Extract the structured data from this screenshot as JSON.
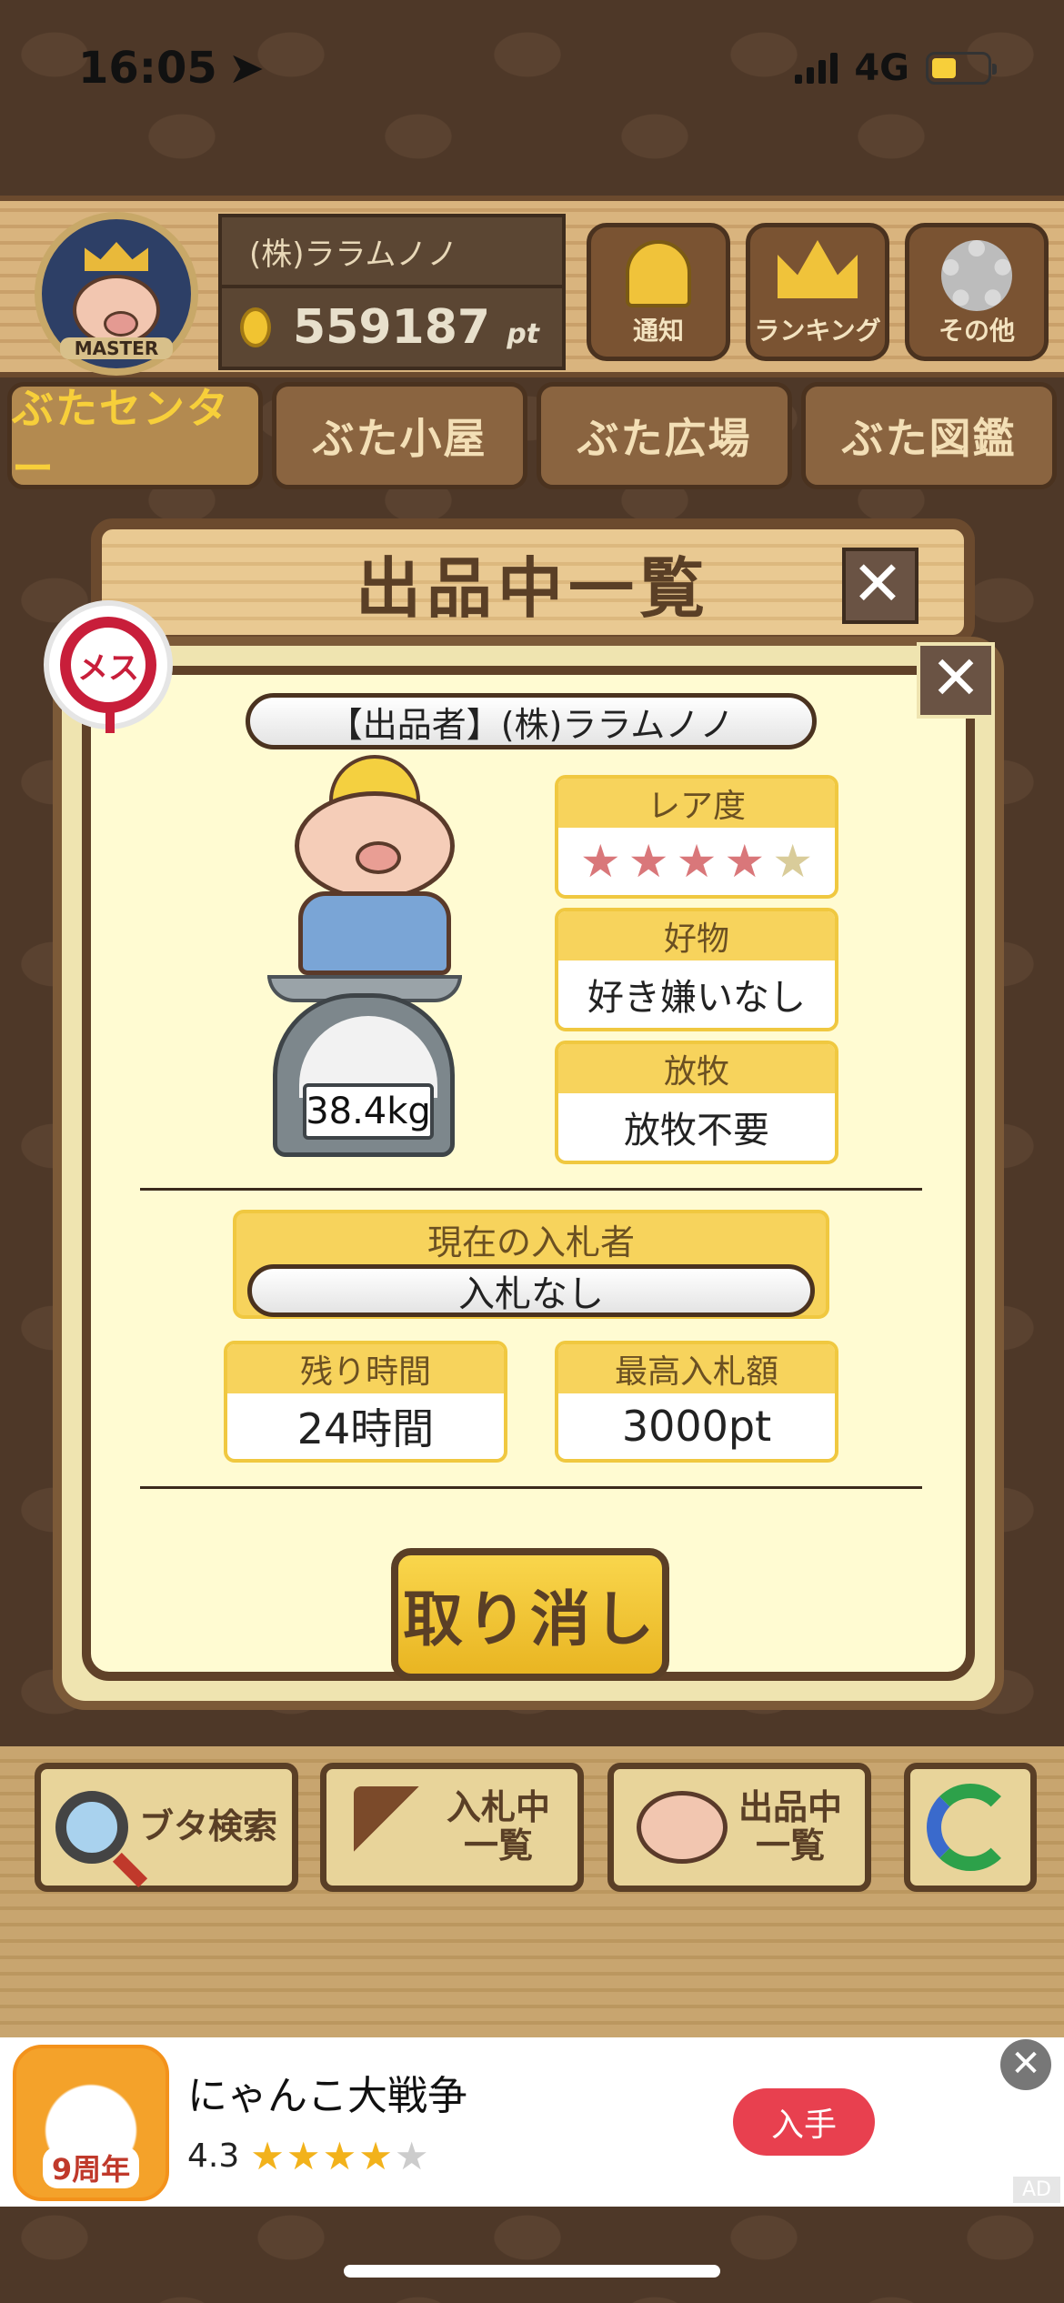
{
  "status_bar": {
    "time": "16:05",
    "network": "4G",
    "battery_level": 0.45
  },
  "header": {
    "badge_label": "MASTER",
    "user_name": "(株)ララムノノ",
    "points": "559187",
    "points_unit": "pt",
    "buttons": [
      {
        "label": "通知",
        "icon": "bell-icon"
      },
      {
        "label": "ランキング",
        "icon": "crown-icon"
      },
      {
        "label": "その他",
        "icon": "gear-icon"
      }
    ]
  },
  "tabs": [
    {
      "label": "ぶたセンター",
      "active": true
    },
    {
      "label": "ぶた小屋",
      "active": false
    },
    {
      "label": "ぶた広場",
      "active": false
    },
    {
      "label": "ぶた図鑑",
      "active": false
    }
  ],
  "modal": {
    "title": "出品中一覧",
    "close": "✕"
  },
  "listing": {
    "gender": "メス",
    "seller": "【出品者】(株)ララムノノ",
    "weight": "38.4kg",
    "rarity": {
      "label": "レア度",
      "stars": 4,
      "max_stars": 5
    },
    "favorite": {
      "label": "好物",
      "value": "好き嫌いなし"
    },
    "grazing": {
      "label": "放牧",
      "value": "放牧不要"
    },
    "current_bidder": {
      "label": "現在の入札者",
      "value": "入札なし"
    },
    "remaining_time": {
      "label": "残り時間",
      "value": "24時間"
    },
    "highest_bid": {
      "label": "最高入札額",
      "value": "3000pt"
    },
    "cancel_button": "取り消し",
    "close": "✕"
  },
  "toolbar": {
    "search": "ブタ検索",
    "bidding_line1": "入札中",
    "bidding_line2": "一覧",
    "listing_line1": "出品中",
    "listing_line2": "一覧"
  },
  "ad": {
    "app_name": "にゃんこ大戦争",
    "icon_label": "9周年",
    "rating": "4.3",
    "rating_value": 4.3,
    "get_button": "入手",
    "close": "✕",
    "tag": "AD"
  },
  "colors": {
    "accent": "#f7d35c",
    "wood": "#7a5332",
    "gender_female": "#c81e3a",
    "ad_button": "#e8404f"
  }
}
